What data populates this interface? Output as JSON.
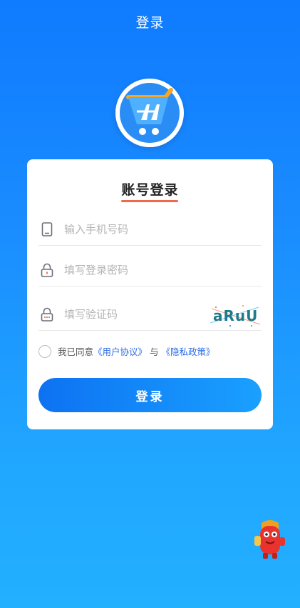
{
  "header": {
    "title": "登录"
  },
  "card": {
    "title": "账号登录",
    "phone_placeholder": "输入手机号码",
    "password_placeholder": "填写登录密码",
    "captcha_placeholder": "填写验证码",
    "captcha_text": "aRuU"
  },
  "agreement": {
    "prefix": "我已同意",
    "user_agreement": "《用户协议》",
    "conjunction": "与",
    "privacy_policy": "《隐私政策》",
    "checked": false
  },
  "login_button": "登录",
  "colors": {
    "accent_blue": "#0f7bff",
    "underline_orange": "#ef6a4c",
    "link_blue": "#2b6de6"
  },
  "icons": {
    "logo": "cart-logo-icon",
    "phone": "phone-icon",
    "password": "lock-icon",
    "captcha": "lock-dots-icon",
    "mascot": "red-mascot-icon"
  }
}
